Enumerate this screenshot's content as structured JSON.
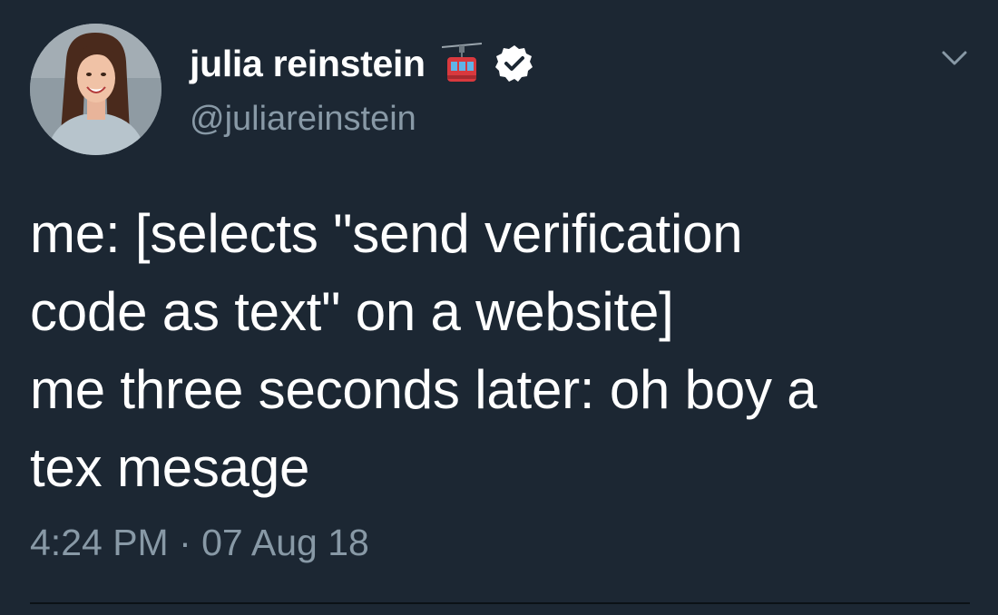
{
  "tweet": {
    "author": {
      "display_name": "julia reinstein",
      "handle": "@juliareinstein",
      "name_emoji": "aerial-tramway-emoji",
      "verified": true
    },
    "text_lines": [
      "me: [selects \"send verification",
      "code as text\" on a website]",
      "me three seconds later: oh boy a",
      "tex mesage"
    ],
    "timestamp": "4:24 PM · 07 Aug 18",
    "menu_icon": "chevron-down-icon"
  },
  "colors": {
    "background": "#1c2733",
    "text": "#ffffff",
    "secondary_text": "#8899a6",
    "verified_badge": "#ffffff"
  }
}
